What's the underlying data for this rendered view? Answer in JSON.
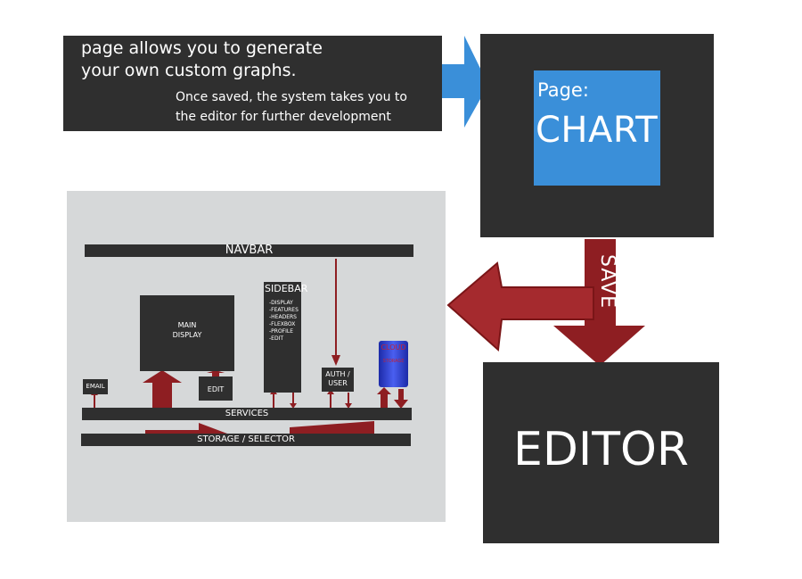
{
  "caption": {
    "line1": "page allows you to generate\nyour own custom graphs.",
    "line2": "Once saved, the system takes you to\nthe editor for further development"
  },
  "chart_page": {
    "label_small": "Page:",
    "label_large": "CHART"
  },
  "save_label": "SAVE",
  "editor_page": {
    "label": "EDITOR"
  },
  "architecture": {
    "navbar": "NAVBAR",
    "main_display": "MAIN\nDISPLAY",
    "sidebar": {
      "title": "SIDEBAR",
      "items": [
        "-DISPLAY",
        "-FEATURES",
        "-HEADERS",
        "-FLEXBOX",
        "-PROFILE",
        "-EDIT"
      ]
    },
    "email": "EMAIL",
    "edit": "EDIT",
    "auth_user": "AUTH /\nUSER",
    "cloud": {
      "line1": "CLOUD",
      "line2": "STORAGE"
    },
    "services": "SERVICES",
    "storage_selector": "STORAGE / SELECTOR"
  },
  "colors": {
    "dark_box": "#2f2f2f",
    "blue": "#3a8fd9",
    "red_arrow": "#8e1e22",
    "diagram_bg": "#d6d8d9"
  }
}
